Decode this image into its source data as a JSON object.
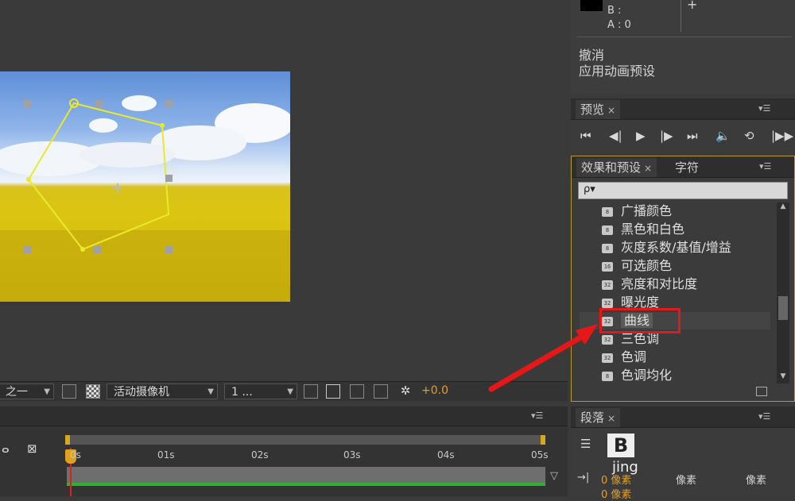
{
  "info_panel": {
    "b_label": "B :",
    "a_label": "A : 0",
    "plus": "+",
    "undo_label": "撤消",
    "apply_label": "应用动画预设"
  },
  "preview_panel": {
    "tab": "预览",
    "close": "×"
  },
  "effects_panel": {
    "tab_effects": "效果和预设",
    "tab_char": "字符",
    "close": "×",
    "search_placeholder": "ρ▾",
    "items": [
      {
        "label": "广播颜色",
        "badge": "8"
      },
      {
        "label": "黑色和白色",
        "badge": "8"
      },
      {
        "label": "灰度系数/基值/增益",
        "badge": "8"
      },
      {
        "label": "可选颜色",
        "badge": "16"
      },
      {
        "label": "亮度和对比度",
        "badge": "32"
      },
      {
        "label": "曝光度",
        "badge": "32"
      },
      {
        "label": "曲线",
        "badge": "32"
      },
      {
        "label": "三色调",
        "badge": "32"
      },
      {
        "label": "色调",
        "badge": "32"
      },
      {
        "label": "色调均化",
        "badge": "8"
      }
    ]
  },
  "viewer_toolbar": {
    "resolution": "之一",
    "camera": "活动摄像机",
    "views": "1 ...",
    "exposure": "+0.0"
  },
  "timeline": {
    "ruler": [
      "0s",
      "01s",
      "02s",
      "03s",
      "04s",
      "05s"
    ]
  },
  "paragraph_panel": {
    "tab": "段落",
    "close": "×",
    "indent_value": "0 像素",
    "indent_value2": "0 像素",
    "indent_label2": "像素",
    "indent_label3": "像素"
  },
  "watermark": {
    "text": "jing",
    "logo_letter": "B"
  }
}
